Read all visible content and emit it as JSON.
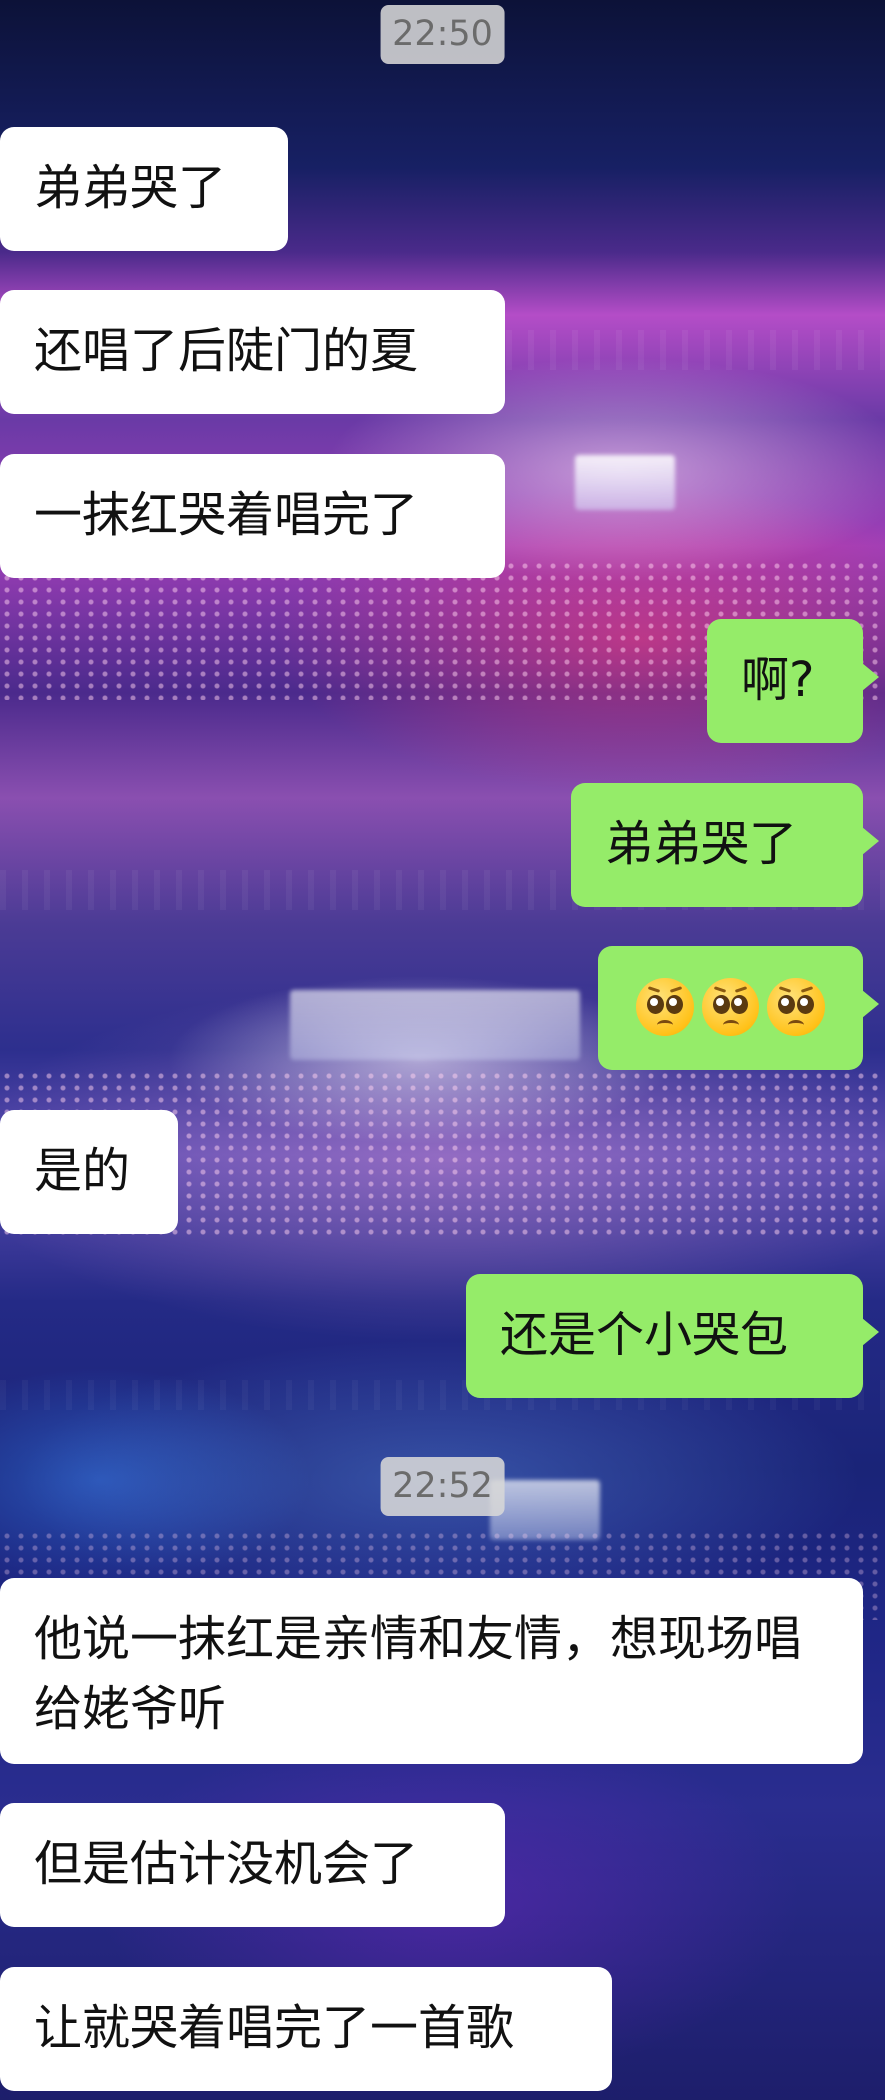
{
  "chat": {
    "timestamps": [
      "22:50",
      "22:52"
    ],
    "messages": [
      {
        "side": "left",
        "text": "弟弟哭了"
      },
      {
        "side": "left",
        "text": "还唱了后陡门的夏"
      },
      {
        "side": "left",
        "text": "一抹红哭着唱完了"
      },
      {
        "side": "right",
        "text": "啊?"
      },
      {
        "side": "right",
        "text": "弟弟哭了"
      },
      {
        "side": "right",
        "emoji": "pleading-face",
        "count": 3
      },
      {
        "side": "left",
        "text": "是的"
      },
      {
        "side": "right",
        "text": "还是个小哭包"
      },
      {
        "side": "left",
        "text": "他说一抹红是亲情和友情，想现场唱给姥爷听"
      },
      {
        "side": "left",
        "text": "但是估计没机会了"
      },
      {
        "side": "left",
        "text": "让就哭着唱完了一首歌"
      }
    ]
  },
  "colors": {
    "sent_bubble": "#95ec69",
    "received_bubble": "#ffffff",
    "timestamp_bg": "#d7d7d7"
  }
}
